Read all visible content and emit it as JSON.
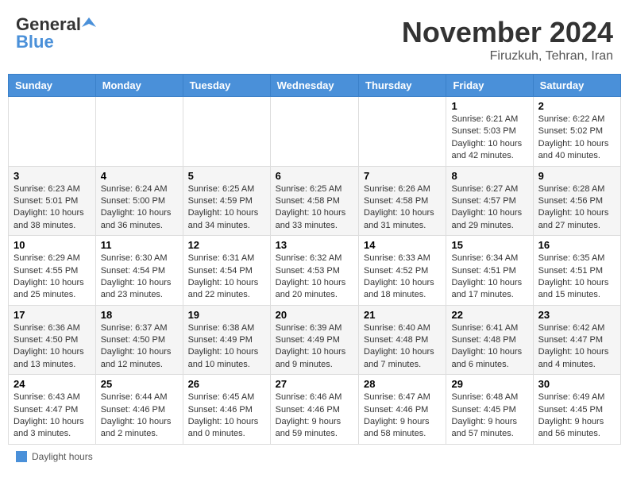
{
  "header": {
    "logo_general": "General",
    "logo_blue": "Blue",
    "month_title": "November 2024",
    "location": "Firuzkuh, Tehran, Iran"
  },
  "days_of_week": [
    "Sunday",
    "Monday",
    "Tuesday",
    "Wednesday",
    "Thursday",
    "Friday",
    "Saturday"
  ],
  "weeks": [
    [
      {
        "day": "",
        "info": ""
      },
      {
        "day": "",
        "info": ""
      },
      {
        "day": "",
        "info": ""
      },
      {
        "day": "",
        "info": ""
      },
      {
        "day": "",
        "info": ""
      },
      {
        "day": "1",
        "info": "Sunrise: 6:21 AM\nSunset: 5:03 PM\nDaylight: 10 hours and 42 minutes."
      },
      {
        "day": "2",
        "info": "Sunrise: 6:22 AM\nSunset: 5:02 PM\nDaylight: 10 hours and 40 minutes."
      }
    ],
    [
      {
        "day": "3",
        "info": "Sunrise: 6:23 AM\nSunset: 5:01 PM\nDaylight: 10 hours and 38 minutes."
      },
      {
        "day": "4",
        "info": "Sunrise: 6:24 AM\nSunset: 5:00 PM\nDaylight: 10 hours and 36 minutes."
      },
      {
        "day": "5",
        "info": "Sunrise: 6:25 AM\nSunset: 4:59 PM\nDaylight: 10 hours and 34 minutes."
      },
      {
        "day": "6",
        "info": "Sunrise: 6:25 AM\nSunset: 4:58 PM\nDaylight: 10 hours and 33 minutes."
      },
      {
        "day": "7",
        "info": "Sunrise: 6:26 AM\nSunset: 4:58 PM\nDaylight: 10 hours and 31 minutes."
      },
      {
        "day": "8",
        "info": "Sunrise: 6:27 AM\nSunset: 4:57 PM\nDaylight: 10 hours and 29 minutes."
      },
      {
        "day": "9",
        "info": "Sunrise: 6:28 AM\nSunset: 4:56 PM\nDaylight: 10 hours and 27 minutes."
      }
    ],
    [
      {
        "day": "10",
        "info": "Sunrise: 6:29 AM\nSunset: 4:55 PM\nDaylight: 10 hours and 25 minutes."
      },
      {
        "day": "11",
        "info": "Sunrise: 6:30 AM\nSunset: 4:54 PM\nDaylight: 10 hours and 23 minutes."
      },
      {
        "day": "12",
        "info": "Sunrise: 6:31 AM\nSunset: 4:54 PM\nDaylight: 10 hours and 22 minutes."
      },
      {
        "day": "13",
        "info": "Sunrise: 6:32 AM\nSunset: 4:53 PM\nDaylight: 10 hours and 20 minutes."
      },
      {
        "day": "14",
        "info": "Sunrise: 6:33 AM\nSunset: 4:52 PM\nDaylight: 10 hours and 18 minutes."
      },
      {
        "day": "15",
        "info": "Sunrise: 6:34 AM\nSunset: 4:51 PM\nDaylight: 10 hours and 17 minutes."
      },
      {
        "day": "16",
        "info": "Sunrise: 6:35 AM\nSunset: 4:51 PM\nDaylight: 10 hours and 15 minutes."
      }
    ],
    [
      {
        "day": "17",
        "info": "Sunrise: 6:36 AM\nSunset: 4:50 PM\nDaylight: 10 hours and 13 minutes."
      },
      {
        "day": "18",
        "info": "Sunrise: 6:37 AM\nSunset: 4:50 PM\nDaylight: 10 hours and 12 minutes."
      },
      {
        "day": "19",
        "info": "Sunrise: 6:38 AM\nSunset: 4:49 PM\nDaylight: 10 hours and 10 minutes."
      },
      {
        "day": "20",
        "info": "Sunrise: 6:39 AM\nSunset: 4:49 PM\nDaylight: 10 hours and 9 minutes."
      },
      {
        "day": "21",
        "info": "Sunrise: 6:40 AM\nSunset: 4:48 PM\nDaylight: 10 hours and 7 minutes."
      },
      {
        "day": "22",
        "info": "Sunrise: 6:41 AM\nSunset: 4:48 PM\nDaylight: 10 hours and 6 minutes."
      },
      {
        "day": "23",
        "info": "Sunrise: 6:42 AM\nSunset: 4:47 PM\nDaylight: 10 hours and 4 minutes."
      }
    ],
    [
      {
        "day": "24",
        "info": "Sunrise: 6:43 AM\nSunset: 4:47 PM\nDaylight: 10 hours and 3 minutes."
      },
      {
        "day": "25",
        "info": "Sunrise: 6:44 AM\nSunset: 4:46 PM\nDaylight: 10 hours and 2 minutes."
      },
      {
        "day": "26",
        "info": "Sunrise: 6:45 AM\nSunset: 4:46 PM\nDaylight: 10 hours and 0 minutes."
      },
      {
        "day": "27",
        "info": "Sunrise: 6:46 AM\nSunset: 4:46 PM\nDaylight: 9 hours and 59 minutes."
      },
      {
        "day": "28",
        "info": "Sunrise: 6:47 AM\nSunset: 4:46 PM\nDaylight: 9 hours and 58 minutes."
      },
      {
        "day": "29",
        "info": "Sunrise: 6:48 AM\nSunset: 4:45 PM\nDaylight: 9 hours and 57 minutes."
      },
      {
        "day": "30",
        "info": "Sunrise: 6:49 AM\nSunset: 4:45 PM\nDaylight: 9 hours and 56 minutes."
      }
    ]
  ],
  "legend": {
    "label": "Daylight hours"
  }
}
